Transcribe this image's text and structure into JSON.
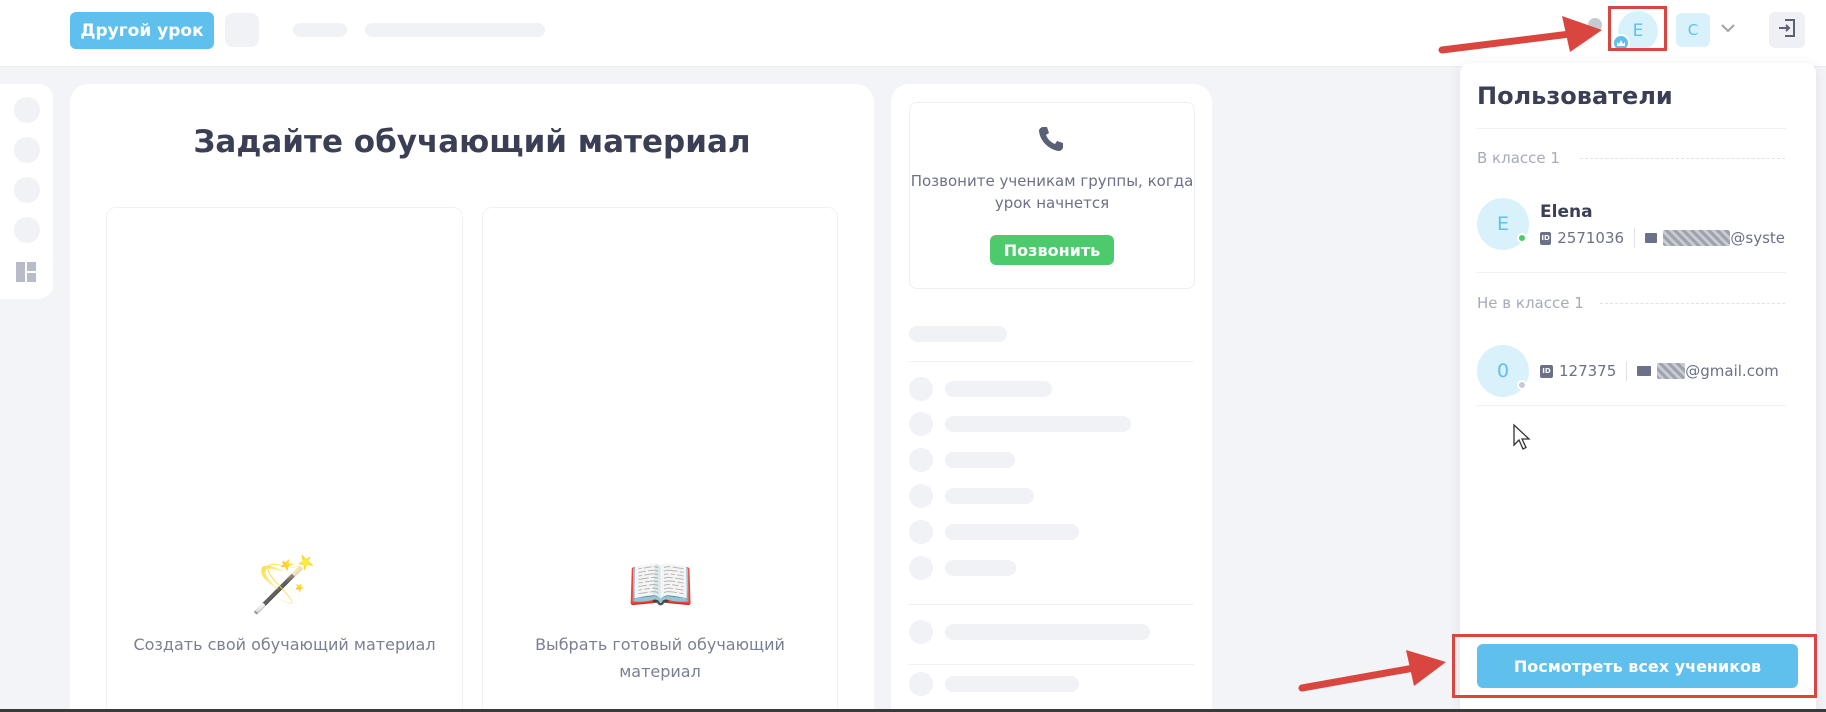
{
  "header": {
    "other_lesson_label": "Другой урок",
    "current_user_initial": "E",
    "account_initial": "C",
    "icons": [
      "chevron-down-icon",
      "logout-icon",
      "crown-icon"
    ]
  },
  "main": {
    "title": "Задайте обучающий материал",
    "options": [
      {
        "emoji": "🪄",
        "label": "Создать свой обучающий материал"
      },
      {
        "emoji": "📖",
        "label": "Выбрать готовый обучающий материал"
      }
    ]
  },
  "call_panel": {
    "text": "Позвоните ученикам группы, когда урок начнется",
    "button_label": "Позвонить"
  },
  "users_panel": {
    "title": "Пользователи",
    "in_class_label": "В классе 1",
    "not_in_class_label": "Не в классе 1",
    "in_class": [
      {
        "initial": "E",
        "name": "Elena",
        "id": "2571036",
        "email_suffix": "@syste",
        "status": "online",
        "status_color": "#4dcb6c"
      }
    ],
    "not_in_class": [
      {
        "initial": "0",
        "id": "127375",
        "email_suffix": "@gmail.com",
        "status": "offline",
        "status_color": "#c7cad3"
      }
    ],
    "view_all_label": "Посмотреть всех учеников"
  },
  "colors": {
    "accent": "#5fc0ee",
    "call_green": "#4dcb6c",
    "annotation_red": "#d9463f"
  }
}
